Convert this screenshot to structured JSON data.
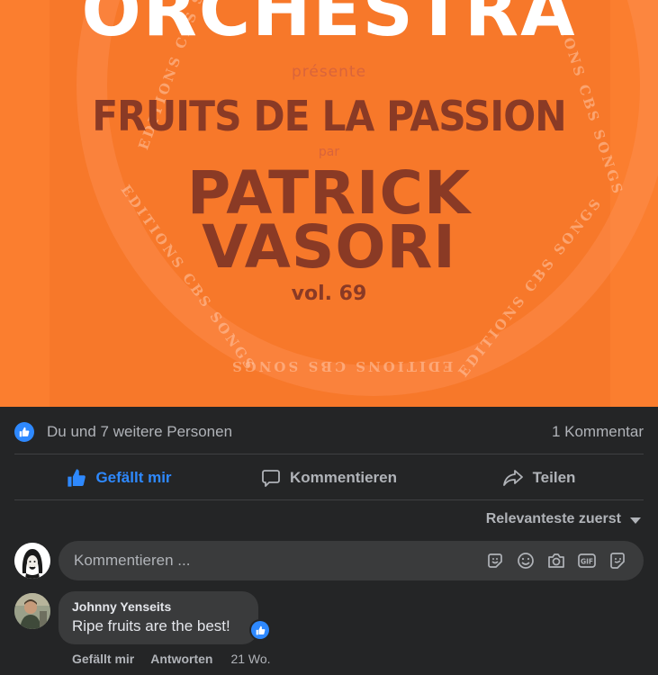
{
  "cover": {
    "orchestra": "ORCHESTRA",
    "presente": "présente",
    "album_title": "FRUITS DE LA PASSION",
    "par": "par",
    "artist_line1": "PATRICK",
    "artist_line2": "VASORI",
    "volume": "vol. 69",
    "ring_text": "EDITIONS CBS SONGS",
    "colors": {
      "background": "#fb7e2f",
      "title": "#8a3a25",
      "accent": "#ffffff"
    }
  },
  "reactions": {
    "who": "Du und 7 weitere Personen",
    "comment_count": "1 Kommentar"
  },
  "actions": {
    "like": "Gefällt mir",
    "comment": "Kommentieren",
    "share": "Teilen"
  },
  "sort": {
    "label": "Relevanteste zuerst"
  },
  "composer": {
    "placeholder": "Kommentieren ...",
    "tools": [
      "sticker-icon",
      "emoji-icon",
      "camera-icon",
      "gif-icon",
      "avatar-sticker-icon"
    ]
  },
  "comment": {
    "author": "Johnny Yenseits",
    "text": "Ripe fruits are the best!",
    "like": "Gefällt mir",
    "reply": "Antworten",
    "time": "21 Wo."
  },
  "colors": {
    "page_bg": "#242526",
    "bubble_bg": "#3a3b3c",
    "accent_blue": "#2e89ff",
    "secondary_text": "#b0b3b8"
  }
}
